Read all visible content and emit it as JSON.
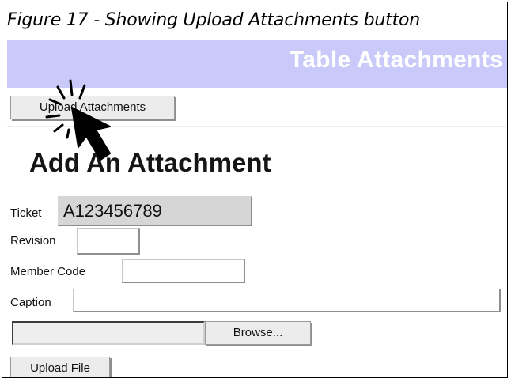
{
  "figure_caption": "Figure 17 - Showing Upload Attachments button",
  "banner": {
    "title": "Table Attachments"
  },
  "toolbar": {
    "upload_attachments_label": "Upload Attachments"
  },
  "form": {
    "heading": "Add An Attachment",
    "ticket": {
      "label": "Ticket",
      "value": "A123456789"
    },
    "revision": {
      "label": "Revision",
      "value": ""
    },
    "member_code": {
      "label": "Member Code",
      "value": ""
    },
    "caption": {
      "label": "Caption",
      "value": ""
    },
    "file": {
      "browse_label": "Browse..."
    },
    "upload_file_label": "Upload File"
  },
  "colors": {
    "banner_bg": "#c9cafa",
    "banner_text": "#ffffff",
    "readonly_bg": "#d6d6d6"
  },
  "icons": {
    "cursor": "click-cursor-icon"
  }
}
